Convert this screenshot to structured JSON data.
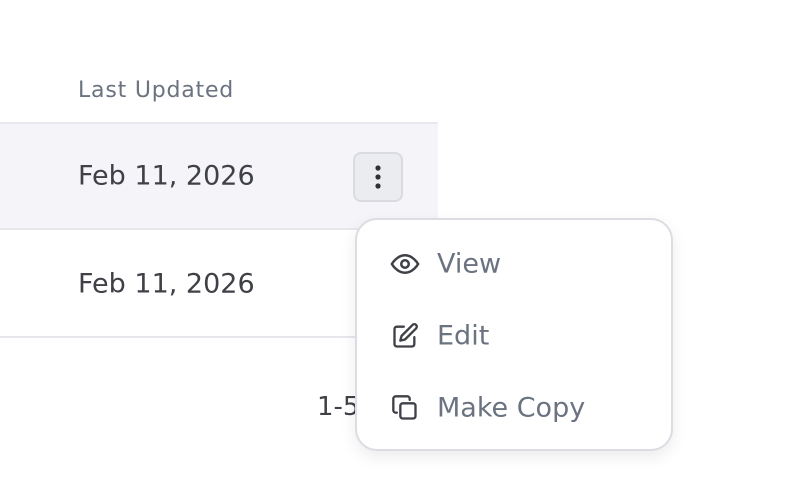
{
  "table": {
    "column_header": "Last Updated",
    "rows": [
      {
        "last_updated": "Feb 11, 2026",
        "highlighted": true
      },
      {
        "last_updated": "Feb 11, 2026",
        "highlighted": false
      }
    ]
  },
  "row_actions": {
    "more_icon": "more-vertical-icon"
  },
  "pagination": {
    "range_text": "1-5"
  },
  "context_menu": {
    "items": [
      {
        "label": "View",
        "icon": "eye-icon"
      },
      {
        "label": "Edit",
        "icon": "pencil-square-icon"
      },
      {
        "label": "Make Copy",
        "icon": "copy-icon"
      }
    ]
  },
  "colors": {
    "row_highlight": "#f4f4f9",
    "text_primary": "#3f4147",
    "text_muted": "#6b7280",
    "border": "#dcdde2"
  }
}
